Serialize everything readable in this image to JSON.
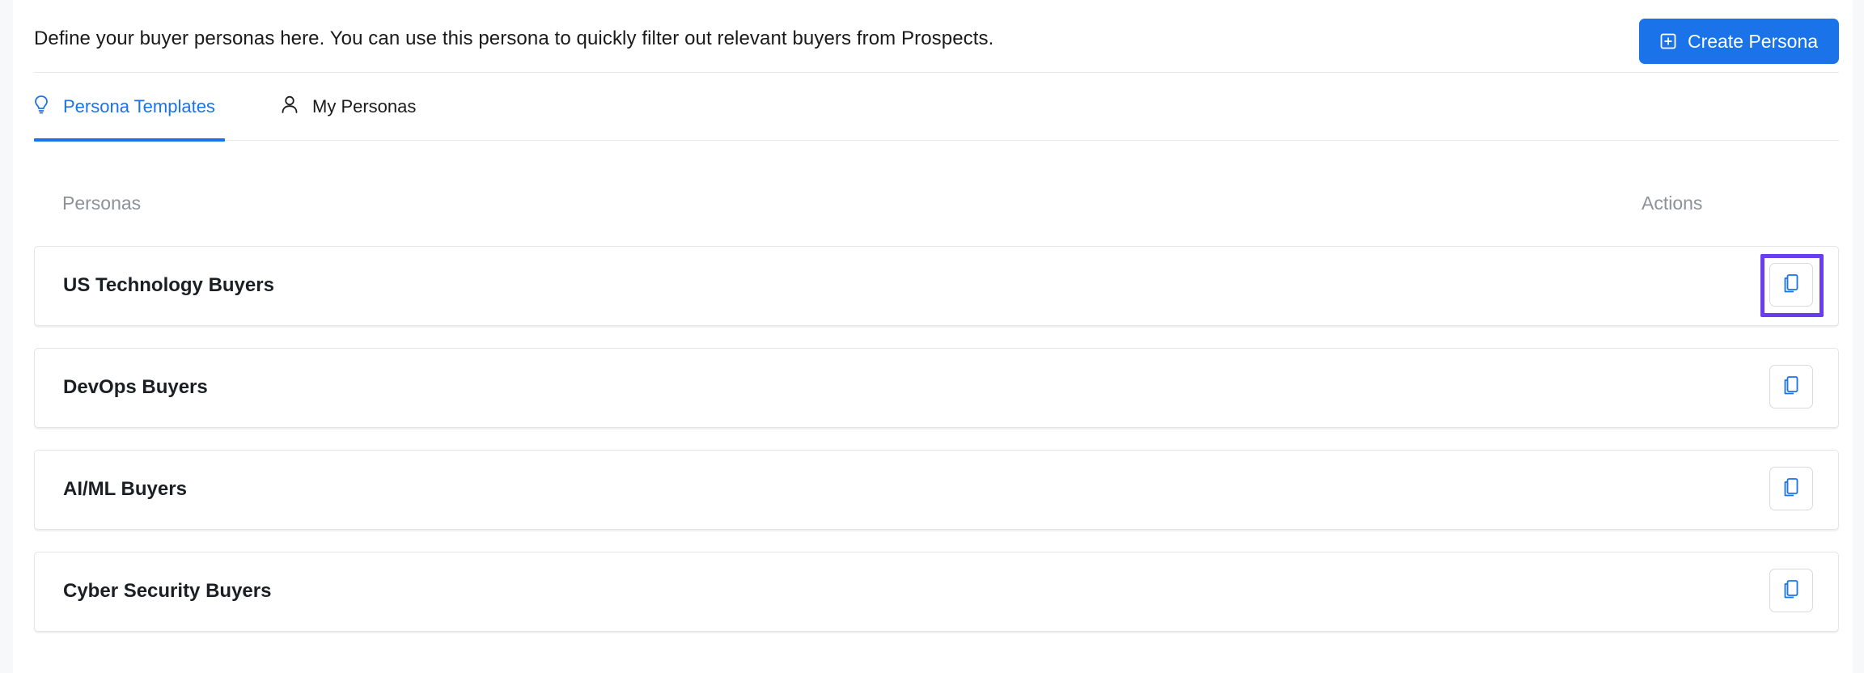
{
  "header": {
    "description": "Define your buyer personas here. You can use this persona to quickly filter out relevant buyers from Prospects.",
    "create_button": {
      "label": "Create Persona",
      "icon": "plus-square-icon"
    }
  },
  "tabs": [
    {
      "label": "Persona Templates",
      "icon": "lightbulb-icon",
      "active": true
    },
    {
      "label": "My Personas",
      "icon": "user-icon",
      "active": false
    }
  ],
  "table": {
    "headers": {
      "personas": "Personas",
      "actions": "Actions"
    },
    "rows": [
      {
        "name": "US Technology Buyers",
        "action_icon": "copy-icon",
        "focused": true
      },
      {
        "name": "DevOps Buyers",
        "action_icon": "copy-icon",
        "focused": false
      },
      {
        "name": "AI/ML Buyers",
        "action_icon": "copy-icon",
        "focused": false
      },
      {
        "name": "Cyber Security Buyers",
        "action_icon": "copy-icon",
        "focused": false
      }
    ]
  },
  "colors": {
    "accent": "#1a73e8",
    "focus_ring": "#6a3df0",
    "muted_text": "#8d9299"
  }
}
